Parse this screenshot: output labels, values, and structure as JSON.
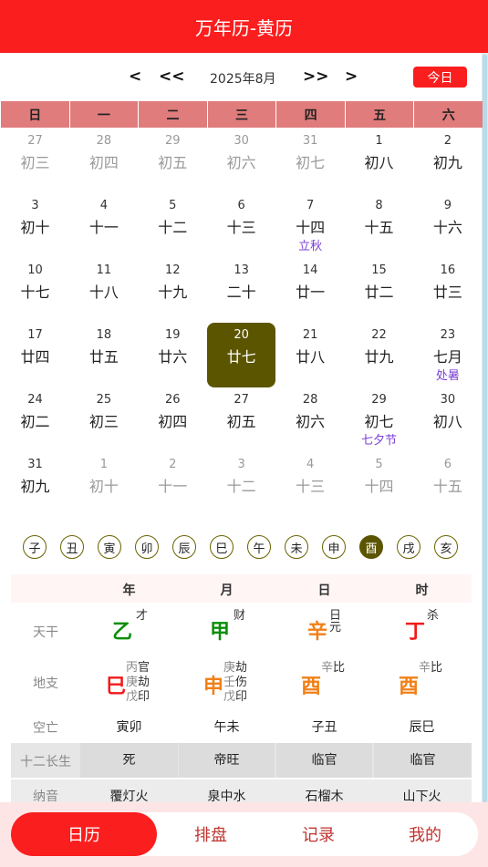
{
  "header": {
    "title": "万年历-黄历"
  },
  "nav": {
    "prev_month": "<",
    "prev_year": "<<",
    "year_month": "2025年8月",
    "next_year": ">>",
    "next_month": ">",
    "today_label": "今日"
  },
  "weekdays": [
    "日",
    "一",
    "二",
    "三",
    "四",
    "五",
    "六"
  ],
  "weeks": [
    [
      {
        "d": "27",
        "l": "初三",
        "o": true
      },
      {
        "d": "28",
        "l": "初四",
        "o": true
      },
      {
        "d": "29",
        "l": "初五",
        "o": true
      },
      {
        "d": "30",
        "l": "初六",
        "o": true
      },
      {
        "d": "31",
        "l": "初七",
        "o": true
      },
      {
        "d": "1",
        "l": "初八"
      },
      {
        "d": "2",
        "l": "初九"
      }
    ],
    [
      {
        "d": "3",
        "l": "初十"
      },
      {
        "d": "4",
        "l": "十一"
      },
      {
        "d": "5",
        "l": "十二"
      },
      {
        "d": "6",
        "l": "十三"
      },
      {
        "d": "7",
        "l": "十四",
        "t": "立秋"
      },
      {
        "d": "8",
        "l": "十五"
      },
      {
        "d": "9",
        "l": "十六"
      }
    ],
    [
      {
        "d": "10",
        "l": "十七"
      },
      {
        "d": "11",
        "l": "十八"
      },
      {
        "d": "12",
        "l": "十九"
      },
      {
        "d": "13",
        "l": "二十"
      },
      {
        "d": "14",
        "l": "廿一"
      },
      {
        "d": "15",
        "l": "廿二"
      },
      {
        "d": "16",
        "l": "廿三"
      }
    ],
    [
      {
        "d": "17",
        "l": "廿四"
      },
      {
        "d": "18",
        "l": "廿五"
      },
      {
        "d": "19",
        "l": "廿六"
      },
      {
        "d": "20",
        "l": "廿七",
        "sel": true
      },
      {
        "d": "21",
        "l": "廿八"
      },
      {
        "d": "22",
        "l": "廿九"
      },
      {
        "d": "23",
        "l": "七月",
        "t": "处暑"
      }
    ],
    [
      {
        "d": "24",
        "l": "初二"
      },
      {
        "d": "25",
        "l": "初三"
      },
      {
        "d": "26",
        "l": "初四"
      },
      {
        "d": "27",
        "l": "初五"
      },
      {
        "d": "28",
        "l": "初六"
      },
      {
        "d": "29",
        "l": "初七",
        "t": "七夕节"
      },
      {
        "d": "30",
        "l": "初八"
      }
    ],
    [
      {
        "d": "31",
        "l": "初九"
      },
      {
        "d": "1",
        "l": "初十",
        "o": true
      },
      {
        "d": "2",
        "l": "十一",
        "o": true
      },
      {
        "d": "3",
        "l": "十二",
        "o": true
      },
      {
        "d": "4",
        "l": "十三",
        "o": true
      },
      {
        "d": "5",
        "l": "十四",
        "o": true
      },
      {
        "d": "6",
        "l": "十五",
        "o": true
      }
    ]
  ],
  "branches": [
    "子",
    "丑",
    "寅",
    "卯",
    "辰",
    "巳",
    "午",
    "未",
    "申",
    "酉",
    "戌",
    "亥"
  ],
  "active_branch": "酉",
  "bazi": {
    "headers": [
      "年",
      "月",
      "日",
      "时"
    ],
    "labels": {
      "gan": "天干",
      "zhi": "地支",
      "kong": "空亡",
      "changsheng": "十二长生",
      "nayin": "纳音"
    },
    "gan": [
      {
        "char": "乙",
        "ten": "才"
      },
      {
        "char": "甲",
        "ten": "财"
      },
      {
        "char": "辛",
        "ten1": "日",
        "ten2": "元"
      },
      {
        "char": "丁",
        "ten": "杀"
      }
    ],
    "zhi": [
      {
        "char": "巳",
        "hidden": [
          [
            "丙",
            "官"
          ],
          [
            "庚",
            "劫"
          ],
          [
            "戊",
            "印"
          ]
        ]
      },
      {
        "char": "申",
        "hidden": [
          [
            "庚",
            "劫"
          ],
          [
            "壬",
            "伤"
          ],
          [
            "戊",
            "印"
          ]
        ]
      },
      {
        "char": "酉",
        "hidden": [
          [
            "辛",
            "比"
          ]
        ]
      },
      {
        "char": "酉",
        "hidden": [
          [
            "辛",
            "比"
          ]
        ]
      }
    ],
    "kong": [
      "寅卯",
      "午未",
      "子丑",
      "辰巳"
    ],
    "changsheng": [
      "死",
      "帝旺",
      "临官",
      "临官"
    ],
    "nayin": [
      "覆灯火",
      "泉中水",
      "石榴木",
      "山下火"
    ]
  },
  "tabs": [
    "日历",
    "排盘",
    "记录",
    "我的"
  ],
  "colors": {
    "brand_red": "#fa1e1e",
    "selected": "#5c5500",
    "festival": "#7b3fd6"
  }
}
